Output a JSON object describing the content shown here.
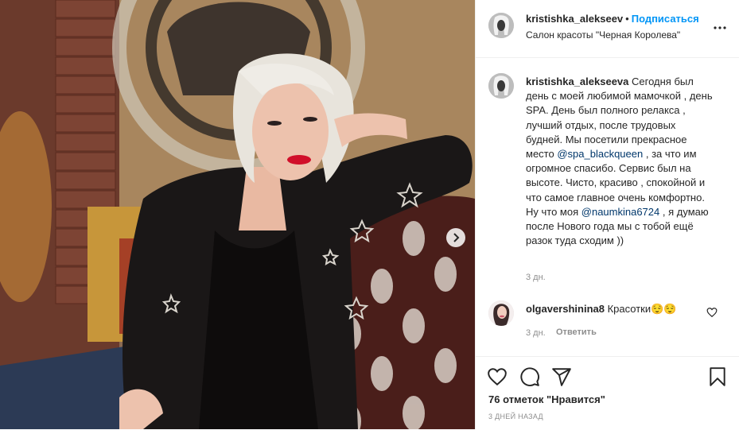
{
  "photo": {
    "alt": "Woman with platinum hair in a black leather jacket sitting on a patterned sofa",
    "next_icon": "chevron-right-icon"
  },
  "header": {
    "username": "kristishka_alekseev",
    "separator": "•",
    "follow_label": "Подписаться",
    "location": "Салон красоты \"Черная Королева\"",
    "more_icon": "more-horizontal-icon"
  },
  "caption": {
    "username": "kristishka_alekseeva",
    "text_1": "Сегодня был день с моей любимой мамочкой , день SPA. День был полного релакса , лучший отдых, после трудовых будней. Мы посетили прекрасное место",
    "mention_1": "@spa_blackqueen",
    "text_2": ", за что им огромное спасибо. Сервис был на высоте. Чисто, красиво , спокойной и что самое главное очень комфортно. Ну что моя",
    "mention_2": "@naumkina6724",
    "text_3": ", я думаю после Нового года мы с тобой ещё разок туда сходим ))",
    "age": "3 дн."
  },
  "comments": [
    {
      "username": "olgavershinina8",
      "text": "Красотки😌😌",
      "age": "3 дн.",
      "reply_label": "Ответить",
      "like_icon": "heart-outline-icon"
    }
  ],
  "actions": {
    "like_icon": "heart-outline-icon",
    "comment_icon": "comment-icon",
    "share_icon": "paper-plane-icon",
    "save_icon": "bookmark-icon",
    "likes_text": "76 отметок \"Нравится\"",
    "date_text": "3 дней назад"
  },
  "colors": {
    "accent": "#0095f6",
    "mention": "#00376b",
    "muted": "#8e8e8e",
    "border": "#efefef"
  }
}
